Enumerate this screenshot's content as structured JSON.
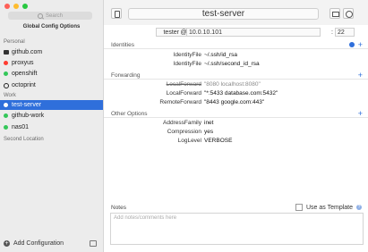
{
  "sidebar": {
    "search_placeholder": "Search",
    "global_config": "Global Config Options",
    "sections": [
      {
        "title": "Personal"
      },
      {
        "title": "Work"
      },
      {
        "title": "Second Location"
      }
    ],
    "hosts": [
      {
        "label": "github.com",
        "icon": "github-icon"
      },
      {
        "label": "proxyus",
        "icon": "red-dot"
      },
      {
        "label": "openshift",
        "icon": "green-dot"
      },
      {
        "label": "octoprint",
        "icon": "octoprint-icon"
      },
      {
        "label": "test-server",
        "icon": "white-dot"
      },
      {
        "label": "github-work",
        "icon": "green-dot"
      },
      {
        "label": "nas01",
        "icon": "green-dot"
      }
    ],
    "add_config": "Add Configuration"
  },
  "header": {
    "title": "test-server",
    "user": "tester",
    "at": "@",
    "host": "10.0.10.101",
    "colon": ":",
    "port": "22"
  },
  "identities": {
    "title": "Identities",
    "rows": [
      {
        "key": "IdentityFile",
        "value": "~/.ssh/id_rsa"
      },
      {
        "key": "IdentityFile",
        "value": "~/.ssh/second_id_rsa"
      }
    ]
  },
  "forwarding": {
    "title": "Forwarding",
    "rows": [
      {
        "key": "LocalForward",
        "value": "\"8080 localhost:8080\""
      },
      {
        "key": "LocalForward",
        "value": "\"*:5433 database.com:5432\""
      },
      {
        "key": "RemoteForward",
        "value": "\"8443 google.com:443\""
      }
    ]
  },
  "other": {
    "title": "Other Options",
    "rows": [
      {
        "key": "AddressFamily",
        "value": "inet"
      },
      {
        "key": "Compression",
        "value": "yes"
      },
      {
        "key": "LogLevel",
        "value": "VERBOSE"
      }
    ]
  },
  "notes": {
    "title": "Notes",
    "placeholder": "Add notes/comments here",
    "use_template": "Use as Template",
    "help": "?"
  },
  "colors": {
    "accent": "#2f6fdb",
    "selected_bg": "#2f6fdb",
    "sidebar_bg": "#ececec"
  }
}
